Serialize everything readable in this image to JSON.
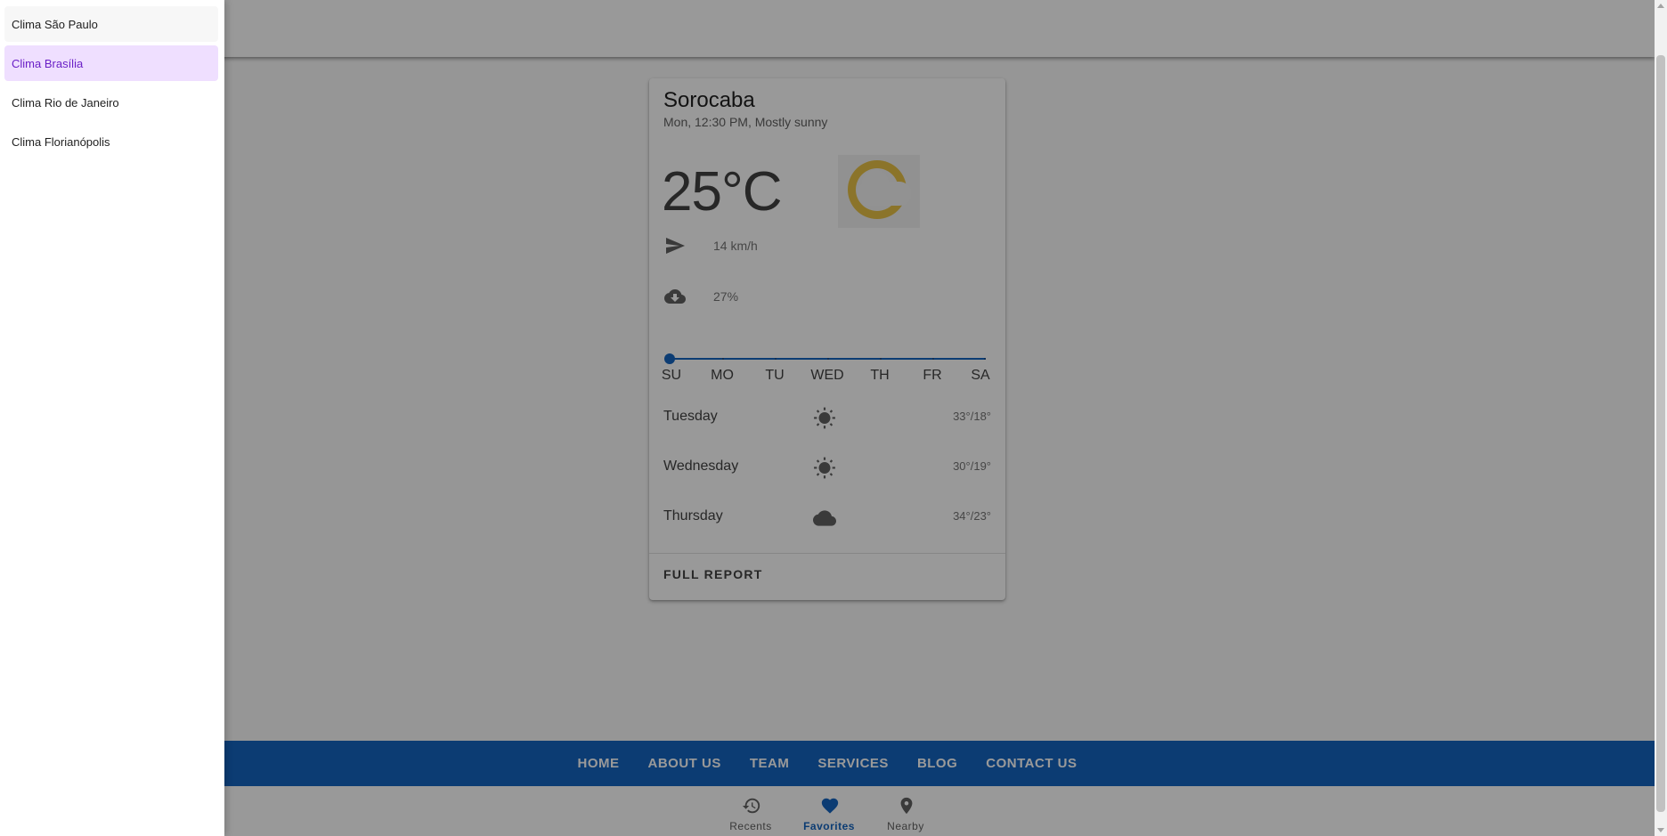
{
  "drawer": {
    "items": [
      {
        "label": "Clima São Paulo"
      },
      {
        "label": "Clima Brasília",
        "selected": true
      },
      {
        "label": "Clima Rio de Janeiro"
      },
      {
        "label": "Clima Florianópolis"
      }
    ]
  },
  "card": {
    "title": "Sorocaba",
    "subtitle": "Mon, 12:30 PM, Mostly sunny",
    "temperature": "25°C",
    "wind": {
      "icon": "send-icon",
      "value": "14 km/h"
    },
    "precipitation": {
      "icon": "cloud-download-icon",
      "value": "27%"
    },
    "day_slider": {
      "labels": [
        "SU",
        "MO",
        "TU",
        "WED",
        "TH",
        "FR",
        "SA"
      ],
      "selected_index": 0
    },
    "forecast": [
      {
        "day": "Tuesday",
        "icon": "sun-icon",
        "temps": "33°/18°"
      },
      {
        "day": "Wednesday",
        "icon": "sun-icon",
        "temps": "30°/19°"
      },
      {
        "day": "Thursday",
        "icon": "cloud-icon",
        "temps": "34°/23°"
      }
    ],
    "action_label": "FULL REPORT"
  },
  "footer": {
    "links": [
      "HOME",
      "ABOUT US",
      "TEAM",
      "SERVICES",
      "BLOG",
      "CONTACT US"
    ]
  },
  "bottom_nav": {
    "items": [
      {
        "label": "Recents",
        "icon": "history-icon"
      },
      {
        "label": "Favorites",
        "icon": "heart-icon",
        "active": true
      },
      {
        "label": "Nearby",
        "icon": "location-pin-icon"
      }
    ]
  },
  "colors": {
    "primary": "#1565c0",
    "drawer_selected_bg": "#efdfff",
    "drawer_selected_text": "#6a1fc6",
    "sun_yellow": "#e8c247"
  }
}
